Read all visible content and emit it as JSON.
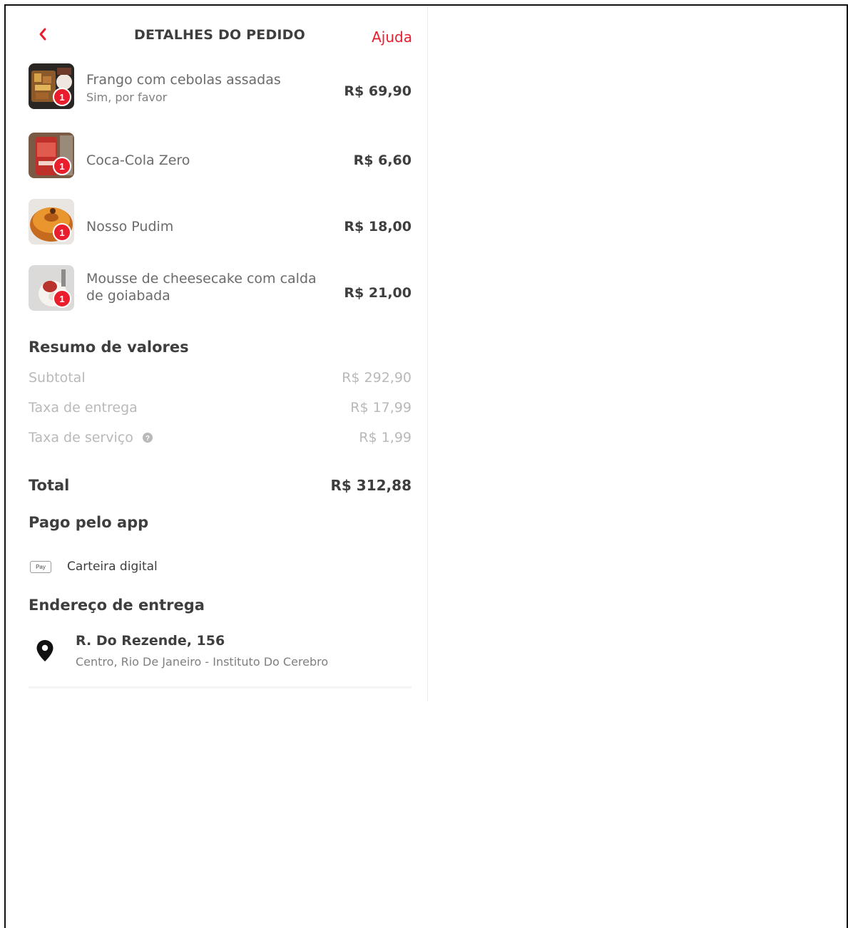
{
  "header": {
    "title": "DETALHES DO PEDIDO",
    "help_label": "Ajuda",
    "back_icon": "chevron-left-icon"
  },
  "colors": {
    "brand": "#ea1d2c",
    "text_dark": "#3f3e3e",
    "text_muted": "#b9b9b9"
  },
  "items": [
    {
      "name": "Frango com cebolas assadas",
      "note": "Sim, por favor",
      "price": "R$ 69,90",
      "qty": "1"
    },
    {
      "name": "Coca-Cola Zero",
      "note": "",
      "price": "R$ 6,60",
      "qty": "1"
    },
    {
      "name": "Nosso Pudim",
      "note": "",
      "price": "R$ 18,00",
      "qty": "1"
    },
    {
      "name": "Mousse de cheesecake com calda de goiabada",
      "note": "",
      "price": "R$ 21,00",
      "qty": "1"
    }
  ],
  "summary": {
    "title": "Resumo de valores",
    "subtotal_label": "Subtotal",
    "subtotal_value": "R$ 292,90",
    "delivery_label": "Taxa de entrega",
    "delivery_value": "R$ 17,99",
    "service_label": "Taxa de serviço",
    "service_value": "R$ 1,99",
    "total_label": "Total",
    "total_value": "R$ 312,88"
  },
  "payment": {
    "title": "Pago pelo app",
    "method_label": "Carteira digital",
    "method_icon_text": "Pay"
  },
  "address": {
    "title": "Endereço de entrega",
    "street": "R. Do Rezende, 156",
    "detail": "Centro, Rio De Janeiro - Instituto Do Cerebro"
  }
}
